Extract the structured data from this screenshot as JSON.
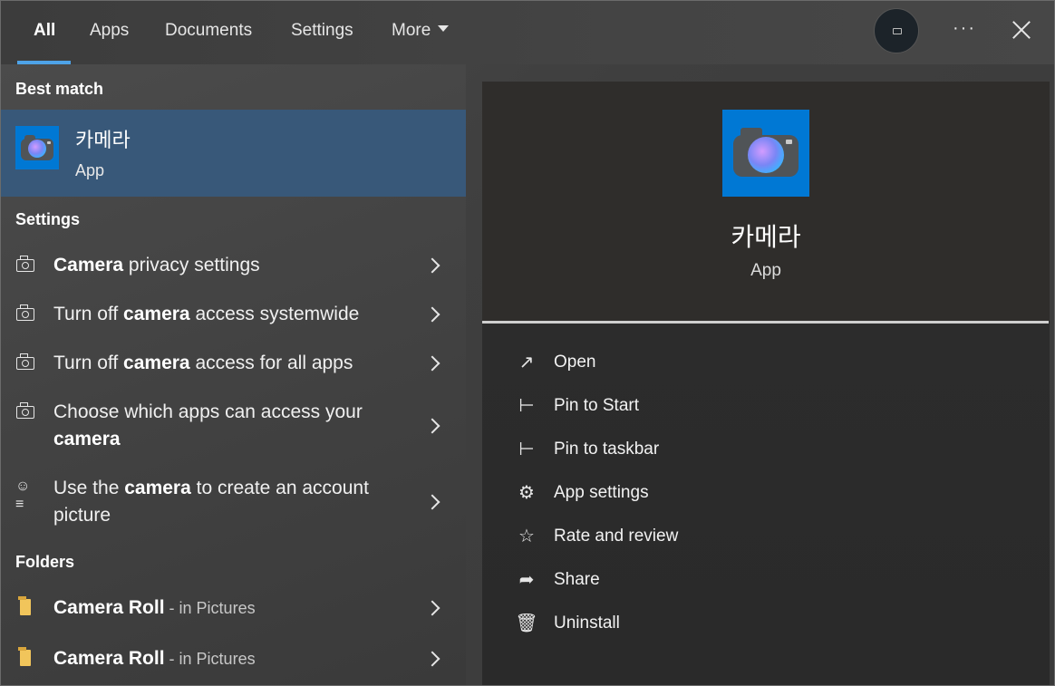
{
  "tabs": [
    {
      "label": "All"
    },
    {
      "label": "Apps"
    },
    {
      "label": "Documents"
    },
    {
      "label": "Settings"
    },
    {
      "label": "More"
    }
  ],
  "colors": {
    "accent": "#4ea3e8",
    "selected_bg": "#385879",
    "app_tile": "#0078d4"
  },
  "sections": {
    "best_match": "Best match",
    "settings": "Settings",
    "folders": "Folders"
  },
  "best_match": {
    "title": "카메라",
    "subtitle": "App",
    "icon": "camera-app-icon"
  },
  "settings_results": [
    {
      "pre": "",
      "bold": "Camera",
      "post": " privacy settings",
      "line2_pre": "",
      "line2_bold": "",
      "line2_post": "",
      "icon": "camera-outline-icon"
    },
    {
      "pre": "Turn off ",
      "bold": "camera",
      "post": " access systemwide",
      "icon": "camera-outline-icon"
    },
    {
      "pre": "Turn off ",
      "bold": "camera",
      "post": " access for all apps",
      "icon": "camera-outline-icon"
    },
    {
      "pre": "Choose which apps can access your",
      "line2_bold": "camera",
      "icon": "camera-outline-icon"
    },
    {
      "pre": "Use the ",
      "bold": "camera",
      "post": " to create an account",
      "line2_post": "picture",
      "icon": "account-picture-icon"
    }
  ],
  "folder_results": [
    {
      "name": "Camera Roll",
      "location": " - in Pictures",
      "icon": "folder-icon"
    },
    {
      "name": "Camera Roll",
      "location": " - in Pictures",
      "icon": "folder-icon"
    }
  ],
  "detail": {
    "title": "카메라",
    "subtitle": "App",
    "actions": [
      {
        "label": "Open",
        "icon": "open-icon"
      },
      {
        "label": "Pin to Start",
        "icon": "pin-icon"
      },
      {
        "label": "Pin to taskbar",
        "icon": "pin-icon"
      },
      {
        "label": "App settings",
        "icon": "gear-icon"
      },
      {
        "label": "Rate and review",
        "icon": "star-icon"
      },
      {
        "label": "Share",
        "icon": "share-icon"
      },
      {
        "label": "Uninstall",
        "icon": "trash-icon"
      }
    ]
  }
}
